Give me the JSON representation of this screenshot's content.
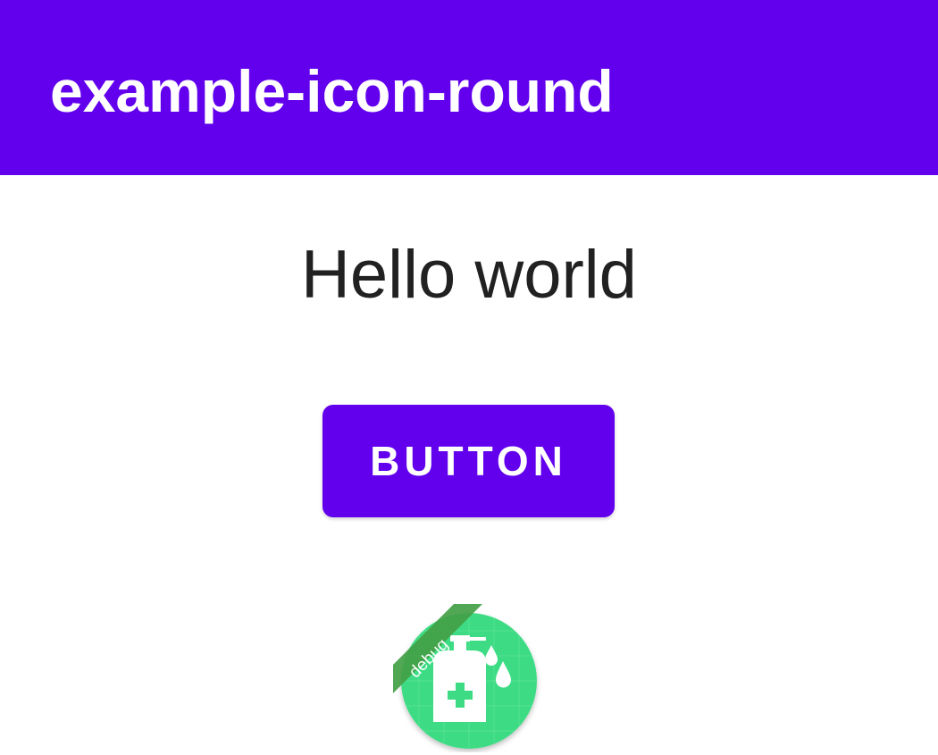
{
  "app_bar": {
    "title": "example-icon-round",
    "color": "#6200EE"
  },
  "main": {
    "greeting": "Hello world",
    "button_label": "BUTTON"
  },
  "app_icon": {
    "icon_name": "hand-sanitizer-icon",
    "badge_label": "debug",
    "background_color": "#3DDC84",
    "badge_color": "#43A047"
  }
}
